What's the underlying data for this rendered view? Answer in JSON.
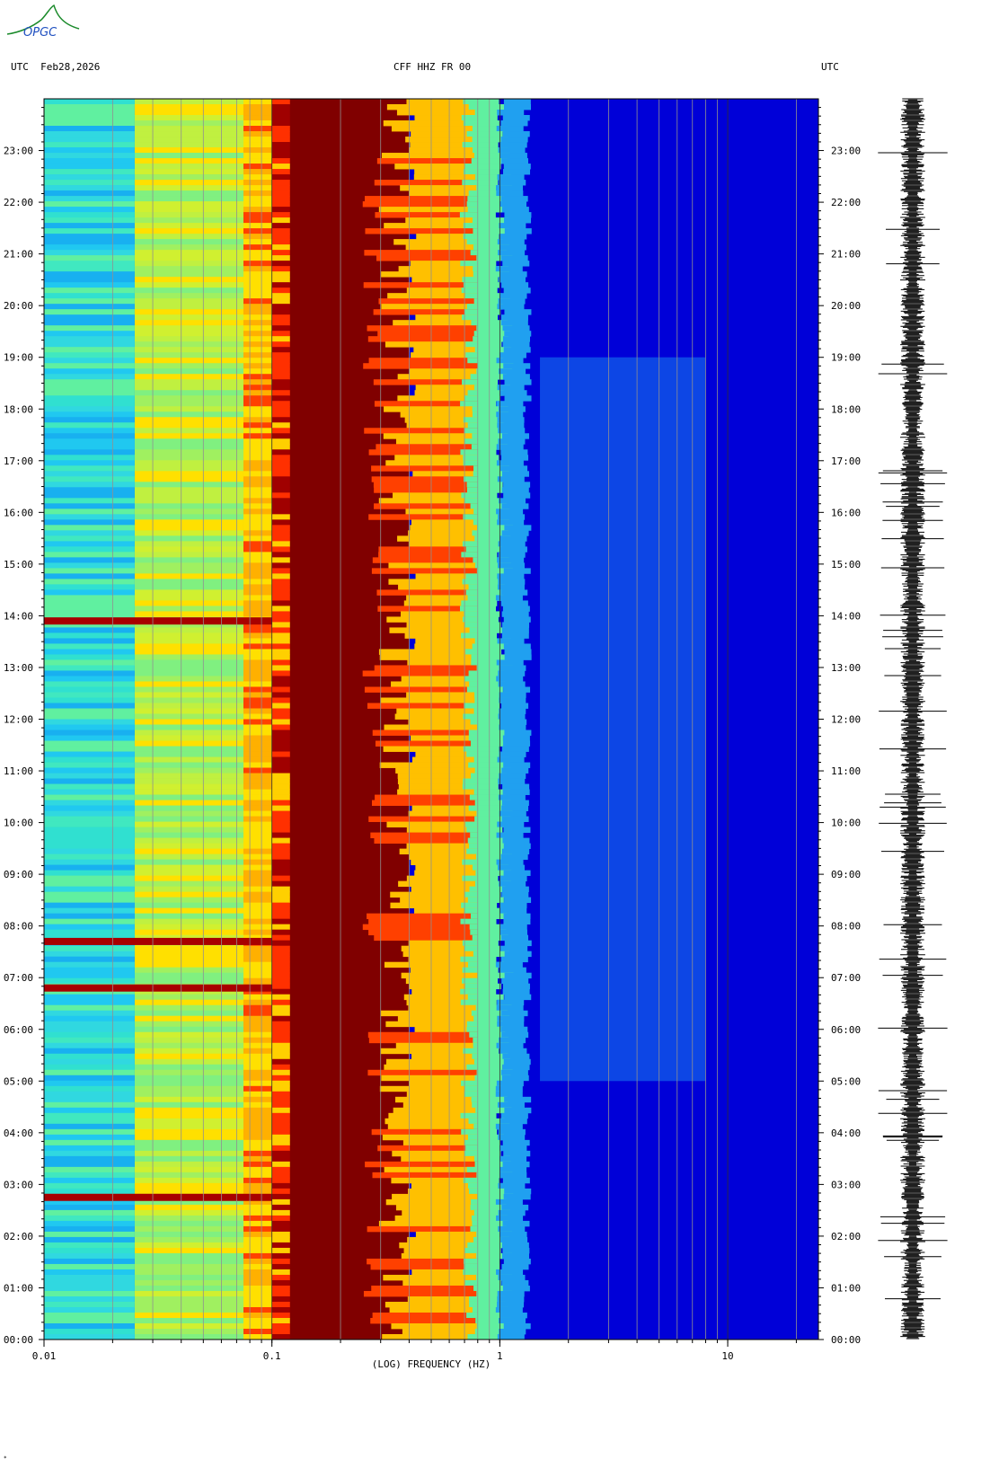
{
  "header": {
    "left": "UTC  Feb28,2026",
    "center": "CFF HHZ FR 00",
    "right": "UTC"
  },
  "logo": {
    "text": "OPGC"
  },
  "footnote": "*",
  "colors": {
    "background": "#0000d8",
    "low_freq_band": "#20d8e8",
    "microseism_band": "#800000",
    "event_line": "#a80000"
  },
  "chart_data": {
    "type": "heatmap",
    "title": "CFF HHZ FR 00",
    "xlabel": "(LOG) FREQUENCY (HZ)",
    "ylabel": "UTC",
    "x_scale": "log",
    "xlim": [
      0.01,
      25
    ],
    "ylim": [
      0,
      24
    ],
    "x_tick_labels": [
      "0.01",
      "0.1",
      "1",
      "10"
    ],
    "x_ticks": [
      0.01,
      0.1,
      1,
      10
    ],
    "y_tick_labels": [
      "00:00",
      "01:00",
      "02:00",
      "03:00",
      "04:00",
      "05:00",
      "06:00",
      "07:00",
      "08:00",
      "09:00",
      "10:00",
      "11:00",
      "12:00",
      "13:00",
      "14:00",
      "15:00",
      "16:00",
      "17:00",
      "18:00",
      "19:00",
      "20:00",
      "21:00",
      "22:00",
      "23:00"
    ],
    "y_ticks": [
      0,
      1,
      2,
      3,
      4,
      5,
      6,
      7,
      8,
      9,
      10,
      11,
      12,
      13,
      14,
      15,
      16,
      17,
      18,
      19,
      20,
      21,
      22,
      23
    ],
    "date": "Feb28,2026",
    "station": "CFF",
    "channel": "HHZ",
    "network": "FR",
    "location": "00",
    "bands": [
      {
        "f_min": 0.01,
        "f_max": 0.1,
        "level": "medium-high",
        "color": "#30e0d0"
      },
      {
        "f_min": 0.1,
        "f_max": 0.4,
        "level": "very-high",
        "color": "#800000"
      },
      {
        "f_min": 0.4,
        "f_max": 0.8,
        "level": "high",
        "color": "#ffd000"
      },
      {
        "f_min": 0.8,
        "f_max": 25,
        "level": "low",
        "color": "#0000d8"
      }
    ],
    "events_utc_hours": [
      2.75,
      6.8,
      7.7,
      13.9
    ],
    "grid": true
  }
}
